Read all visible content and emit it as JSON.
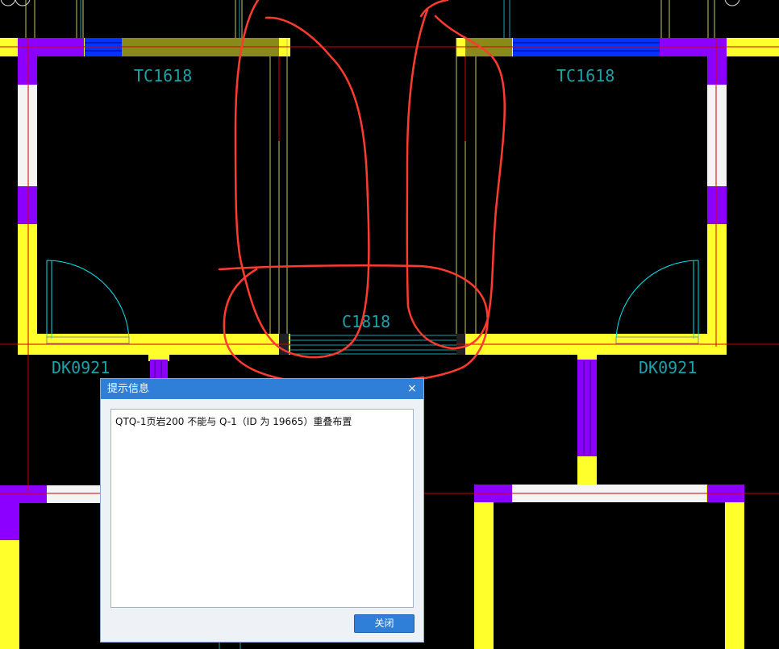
{
  "drawing": {
    "window_labels": [
      "TC1618",
      "TC1618",
      "C1818"
    ],
    "door_labels": [
      "DK0921",
      "DK0921"
    ],
    "colors": {
      "background": "#000000",
      "wall": "#ffff2b",
      "column": "#8b00ff",
      "window": "#0033ff",
      "annotation": "#ff3333",
      "label": "#1ea0a8",
      "door_arc": "#00e5ee",
      "axis": "#d00000"
    }
  },
  "dialog": {
    "title": "提示信息",
    "close_glyph": "×",
    "message": "QTQ-1页岩200 不能与 Q-1（ID 为 19665）重叠布置",
    "button_label": "关闭"
  }
}
